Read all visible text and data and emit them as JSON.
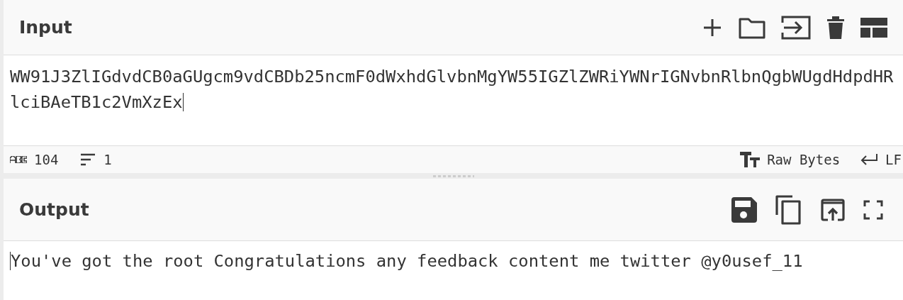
{
  "input": {
    "title": "Input",
    "value": "WW91J3ZlIGdvdCB0aGUgcm9vdCBDb25ncmF0dWxhdGlvbnMgYW55IGZlZWRiYWNrIGNvbnRlbnQgbWUgdHdpdHRlciBAeTB1c2VmXzEx",
    "status": {
      "length": "104",
      "lines": "1",
      "encoding": "Raw Bytes",
      "eol": "LF"
    }
  },
  "output": {
    "title": "Output",
    "value": "You've got the root Congratulations any feedback content me twitter @y0usef_11"
  }
}
